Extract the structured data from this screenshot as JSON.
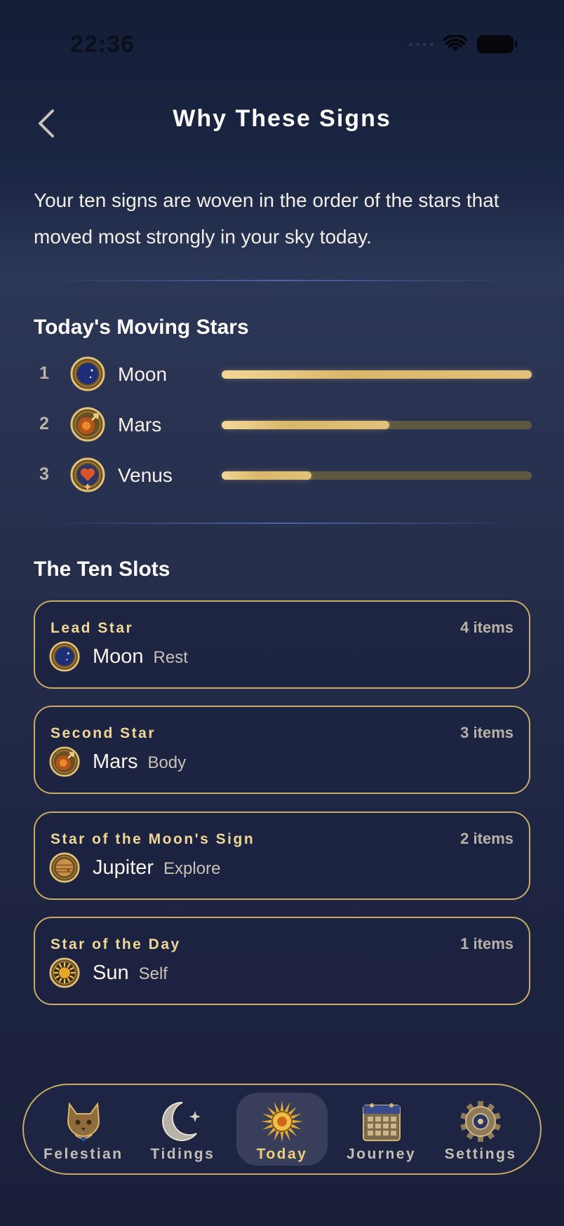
{
  "status_bar": {
    "time": "22:36"
  },
  "header": {
    "title": "Why These Signs"
  },
  "intro": "Your ten signs are woven in the order of the stars that moved most strongly in your sky today.",
  "moving_stars": {
    "title": "Today's Moving Stars",
    "items": [
      {
        "rank": "1",
        "name": "Moon",
        "icon": "moon-medallion-icon",
        "strength": 1.0
      },
      {
        "rank": "2",
        "name": "Mars",
        "icon": "mars-medallion-icon",
        "strength": 0.54
      },
      {
        "rank": "3",
        "name": "Venus",
        "icon": "venus-medallion-icon",
        "strength": 0.29
      }
    ]
  },
  "ten_slots": {
    "title": "The Ten Slots",
    "cards": [
      {
        "label": "Lead Star",
        "count": "4 items",
        "planet": "Moon",
        "theme": "Rest",
        "icon": "moon-medallion-icon"
      },
      {
        "label": "Second Star",
        "count": "3 items",
        "planet": "Mars",
        "theme": "Body",
        "icon": "mars-medallion-icon"
      },
      {
        "label": "Star of the Moon's Sign",
        "count": "2 items",
        "planet": "Jupiter",
        "theme": "Explore",
        "icon": "jupiter-medallion-icon"
      },
      {
        "label": "Star of the Day",
        "count": "1 items",
        "planet": "Sun",
        "theme": "Self",
        "icon": "sun-medallion-icon"
      }
    ]
  },
  "tab_bar": {
    "active": "Today",
    "tabs": [
      {
        "label": "Felestian",
        "icon": "cat-icon"
      },
      {
        "label": "Tidings",
        "icon": "crescent-moon-icon"
      },
      {
        "label": "Today",
        "icon": "sun-icon"
      },
      {
        "label": "Journey",
        "icon": "calendar-icon"
      },
      {
        "label": "Settings",
        "icon": "gear-icon"
      }
    ]
  },
  "colors": {
    "accent_gold": "#c9ab66",
    "label_gold": "#f1d796",
    "bar_track": "#5d5840",
    "background": "#1e2542"
  }
}
